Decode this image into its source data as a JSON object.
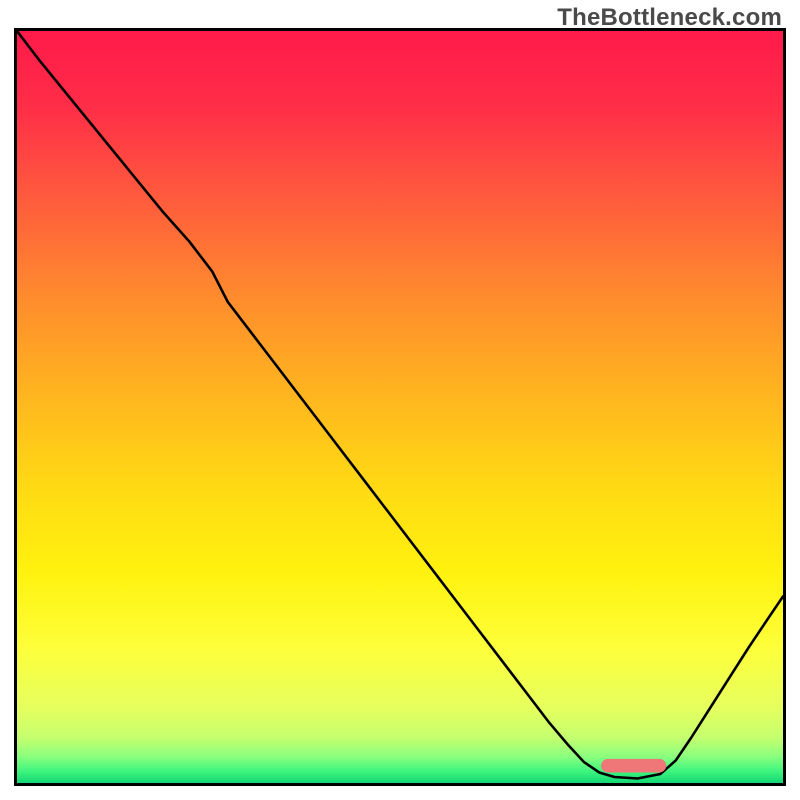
{
  "watermark": "TheBottleneck.com",
  "chart_data": {
    "type": "line",
    "title": "",
    "xlabel": "",
    "ylabel": "",
    "xlim": [
      0,
      1
    ],
    "ylim": [
      0,
      1
    ],
    "grid": false,
    "legend": false,
    "gradient_stops": [
      {
        "offset": 0.0,
        "color": "#ff1a4a"
      },
      {
        "offset": 0.1,
        "color": "#ff2d47"
      },
      {
        "offset": 0.22,
        "color": "#ff5a3d"
      },
      {
        "offset": 0.35,
        "color": "#ff8a2e"
      },
      {
        "offset": 0.48,
        "color": "#ffb41f"
      },
      {
        "offset": 0.6,
        "color": "#ffd814"
      },
      {
        "offset": 0.72,
        "color": "#fff20e"
      },
      {
        "offset": 0.82,
        "color": "#fdff3a"
      },
      {
        "offset": 0.9,
        "color": "#e6ff5e"
      },
      {
        "offset": 0.94,
        "color": "#c4ff6e"
      },
      {
        "offset": 0.965,
        "color": "#8aff7e"
      },
      {
        "offset": 0.985,
        "color": "#3cf47e"
      },
      {
        "offset": 1.0,
        "color": "#12d775"
      }
    ],
    "series": [
      {
        "name": "bottleneck-curve",
        "stroke": "#000000",
        "stroke_width": 2.6,
        "points": [
          {
            "x": 0.0,
            "y": 1.0
          },
          {
            "x": 0.03,
            "y": 0.96
          },
          {
            "x": 0.07,
            "y": 0.91
          },
          {
            "x": 0.11,
            "y": 0.86
          },
          {
            "x": 0.15,
            "y": 0.81
          },
          {
            "x": 0.19,
            "y": 0.76
          },
          {
            "x": 0.225,
            "y": 0.72
          },
          {
            "x": 0.255,
            "y": 0.68
          },
          {
            "x": 0.275,
            "y": 0.64
          },
          {
            "x": 0.305,
            "y": 0.6
          },
          {
            "x": 0.335,
            "y": 0.56
          },
          {
            "x": 0.365,
            "y": 0.52
          },
          {
            "x": 0.395,
            "y": 0.48
          },
          {
            "x": 0.425,
            "y": 0.44
          },
          {
            "x": 0.455,
            "y": 0.4
          },
          {
            "x": 0.485,
            "y": 0.36
          },
          {
            "x": 0.515,
            "y": 0.32
          },
          {
            "x": 0.545,
            "y": 0.28
          },
          {
            "x": 0.575,
            "y": 0.24
          },
          {
            "x": 0.605,
            "y": 0.2
          },
          {
            "x": 0.635,
            "y": 0.16
          },
          {
            "x": 0.665,
            "y": 0.12
          },
          {
            "x": 0.695,
            "y": 0.08
          },
          {
            "x": 0.72,
            "y": 0.05
          },
          {
            "x": 0.74,
            "y": 0.028
          },
          {
            "x": 0.76,
            "y": 0.014
          },
          {
            "x": 0.78,
            "y": 0.008
          },
          {
            "x": 0.81,
            "y": 0.006
          },
          {
            "x": 0.84,
            "y": 0.012
          },
          {
            "x": 0.86,
            "y": 0.03
          },
          {
            "x": 0.88,
            "y": 0.06
          },
          {
            "x": 0.905,
            "y": 0.1
          },
          {
            "x": 0.93,
            "y": 0.14
          },
          {
            "x": 0.955,
            "y": 0.18
          },
          {
            "x": 0.98,
            "y": 0.218
          },
          {
            "x": 1.0,
            "y": 0.248
          }
        ]
      }
    ],
    "marker": {
      "name": "optimal-marker",
      "shape": "rounded-bar",
      "color": "#f07777",
      "x_center": 0.805,
      "y_center": 0.023,
      "width": 0.085,
      "height": 0.018
    }
  }
}
